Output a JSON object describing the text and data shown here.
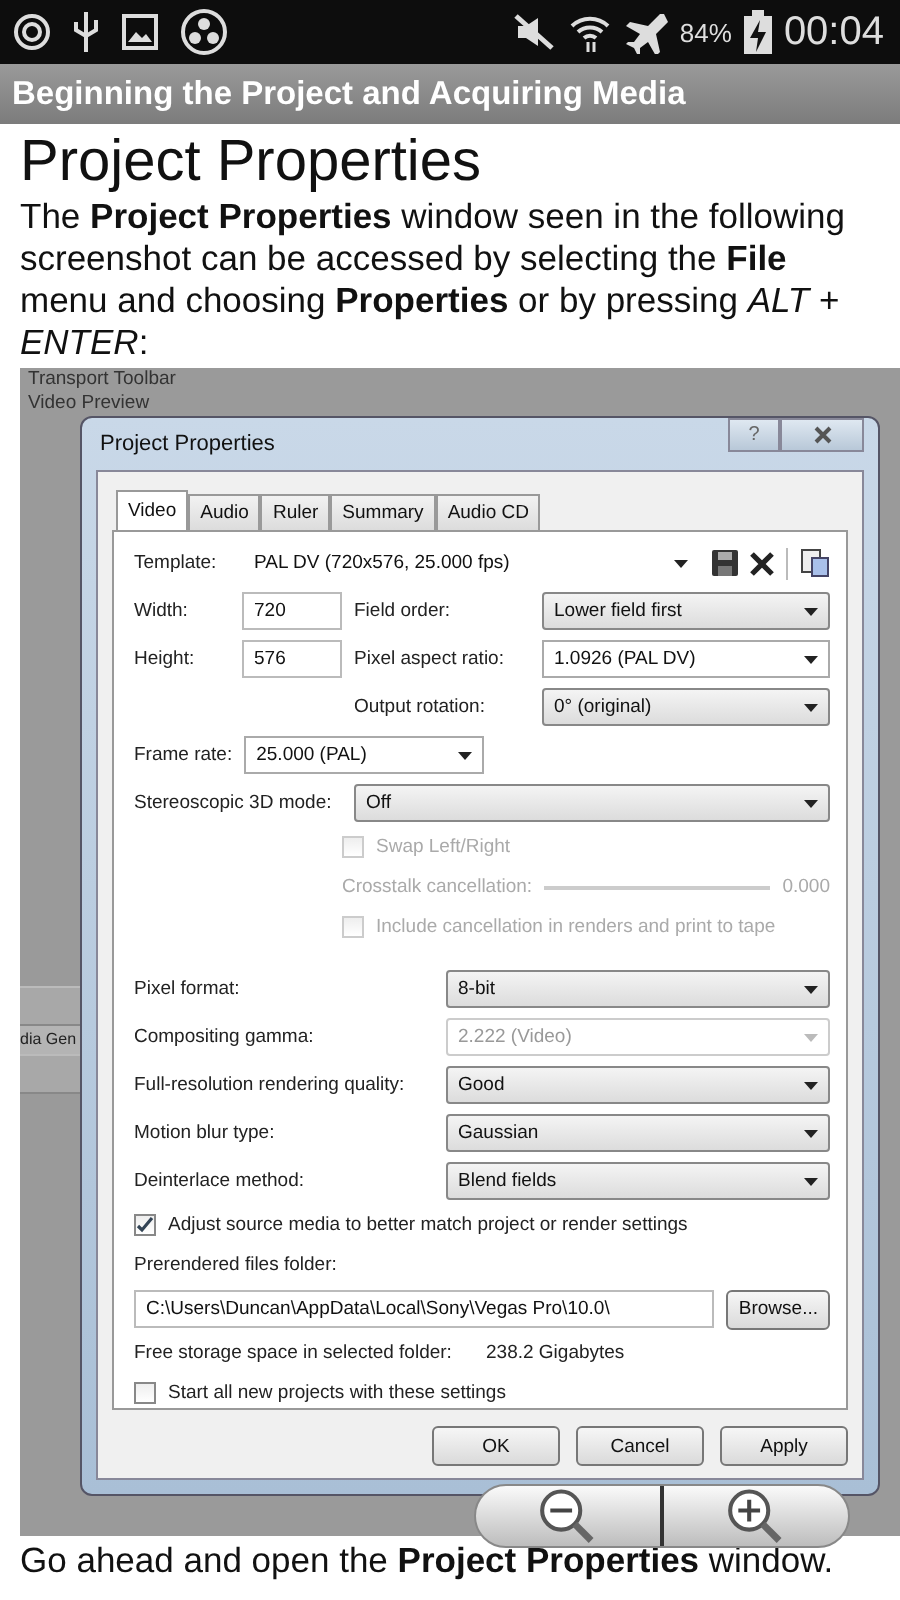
{
  "status_bar": {
    "battery": "84%",
    "time": "00:04"
  },
  "header": {
    "title": "Beginning the Project and Acquiring Media"
  },
  "article": {
    "title": "Project Properties",
    "intro": "The **Project Properties** window seen in the following screenshot can be accessed by selecting the **File** menu and choosing **Properties** or by pressing *ALT* + *ENTER*:",
    "outro": "Go ahead and open the **Project Properties** window."
  },
  "screenshot": {
    "background_items": [
      "Transport Toolbar",
      "Video Preview"
    ],
    "side_tab": "dia Gen",
    "dialog": {
      "title": "Project Properties",
      "help": "?",
      "tabs": [
        {
          "label": "Video",
          "selected": true
        },
        {
          "label": "Audio",
          "selected": false
        },
        {
          "label": "Ruler",
          "selected": false
        },
        {
          "label": "Summary",
          "selected": false
        },
        {
          "label": "Audio CD",
          "selected": false
        }
      ],
      "template": {
        "label": "Template:",
        "value": "PAL DV (720x576, 25.000 fps)"
      },
      "dims": [
        {
          "label": "Width:",
          "value": "720"
        },
        {
          "label": "Height:",
          "value": "576"
        }
      ],
      "formats": [
        {
          "label": "Field order:",
          "value": "Lower field first",
          "kind": "list"
        },
        {
          "label": "Pixel aspect ratio:",
          "value": "1.0926 (PAL DV)",
          "kind": "combo"
        },
        {
          "label": "Output rotation:",
          "value": "0° (original)",
          "kind": "list"
        }
      ],
      "frame_rate": {
        "label": "Frame rate:",
        "value": "25.000 (PAL)"
      },
      "stereo": {
        "label": "Stereoscopic 3D mode:",
        "value": "Off"
      },
      "swap": {
        "label": "Swap Left/Right",
        "checked": false,
        "disabled": true
      },
      "crosstalk": {
        "label": "Crosstalk cancellation:",
        "value": "0.000",
        "disabled": true
      },
      "include": {
        "label": "Include cancellation in renders and print to tape",
        "checked": false,
        "disabled": true
      },
      "settings": [
        {
          "label": "Pixel format:",
          "value": "8-bit",
          "disabled": false
        },
        {
          "label": "Compositing gamma:",
          "value": "2.222 (Video)",
          "disabled": true
        },
        {
          "label": "Full-resolution rendering quality:",
          "value": "Good",
          "disabled": false
        },
        {
          "label": "Motion blur type:",
          "value": "Gaussian",
          "disabled": false
        },
        {
          "label": "Deinterlace method:",
          "value": "Blend fields",
          "disabled": false
        }
      ],
      "adjust": {
        "label": "Adjust source media to better match project or render settings",
        "checked": true
      },
      "folder": {
        "label": "Prerendered files folder:",
        "value": "C:\\Users\\Duncan\\AppData\\Local\\Sony\\Vegas Pro\\10.0\\",
        "browse": "Browse..."
      },
      "free": {
        "label": "Free storage space in selected folder:",
        "value": "238.2 Gigabytes"
      },
      "start_all": {
        "label": "Start all new projects with these settings",
        "checked": false
      },
      "buttons": [
        "OK",
        "Cancel",
        "Apply"
      ]
    }
  }
}
